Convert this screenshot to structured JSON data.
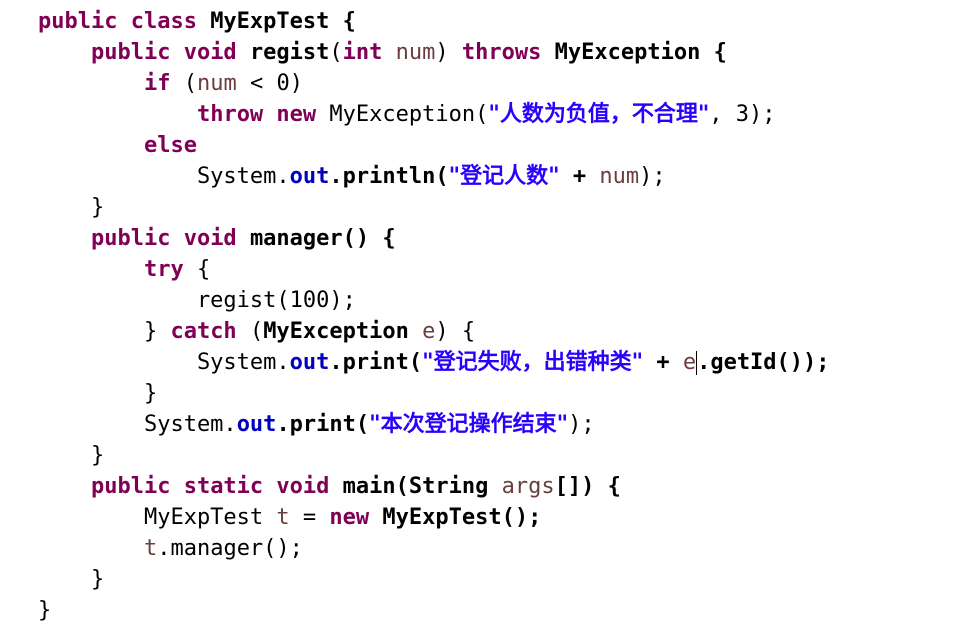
{
  "editor": {
    "lines": [
      {
        "tokens": [
          {
            "t": "public class ",
            "c": "kw"
          },
          {
            "t": "MyExpTest {",
            "c": "bold"
          }
        ]
      },
      {
        "tokens": [
          {
            "t": "    "
          },
          {
            "t": "public void ",
            "c": "kw"
          },
          {
            "t": "regist",
            "c": "bold"
          },
          {
            "t": "("
          },
          {
            "t": "int ",
            "c": "kw"
          },
          {
            "t": "num",
            "c": "var"
          },
          {
            "t": ") "
          },
          {
            "t": "throws ",
            "c": "kw"
          },
          {
            "t": "MyException {",
            "c": "bold"
          }
        ]
      },
      {
        "tokens": [
          {
            "t": "        "
          },
          {
            "t": "if ",
            "c": "kw"
          },
          {
            "t": "("
          },
          {
            "t": "num",
            "c": "var"
          },
          {
            "t": " < 0)"
          }
        ]
      },
      {
        "tokens": [
          {
            "t": "            "
          },
          {
            "t": "throw new ",
            "c": "kw"
          },
          {
            "t": "MyException("
          },
          {
            "t": "\"人数为负值，不合理\"",
            "c": "str-cn"
          },
          {
            "t": ", 3);"
          }
        ]
      },
      {
        "tokens": [
          {
            "t": "        "
          },
          {
            "t": "else",
            "c": "kw"
          }
        ]
      },
      {
        "tokens": [
          {
            "t": "            System."
          },
          {
            "t": "out",
            "c": "field"
          },
          {
            "t": ".println(",
            "c": "bold"
          },
          {
            "t": "\"登记人数\"",
            "c": "str-cn"
          },
          {
            "t": " + ",
            "c": "bold"
          },
          {
            "t": "num",
            "c": "var"
          },
          {
            "t": ");"
          }
        ]
      },
      {
        "tokens": [
          {
            "t": "    }"
          }
        ]
      },
      {
        "tokens": [
          {
            "t": "    "
          },
          {
            "t": "public void ",
            "c": "kw"
          },
          {
            "t": "manager() {",
            "c": "bold"
          }
        ]
      },
      {
        "tokens": [
          {
            "t": "        "
          },
          {
            "t": "try",
            "c": "kw"
          },
          {
            "t": " {"
          }
        ]
      },
      {
        "tokens": [
          {
            "t": "            regist(100);"
          }
        ]
      },
      {
        "tokens": [
          {
            "t": "        } "
          },
          {
            "t": "catch ",
            "c": "kw"
          },
          {
            "t": "("
          },
          {
            "t": "MyException ",
            "c": "bold"
          },
          {
            "t": "e",
            "c": "var"
          },
          {
            "t": ") {"
          }
        ]
      },
      {
        "tokens": [
          {
            "t": "            System."
          },
          {
            "t": "out",
            "c": "field"
          },
          {
            "t": ".print(",
            "c": "bold"
          },
          {
            "t": "\"登记失败，出错种类\"",
            "c": "str-cn"
          },
          {
            "t": " + ",
            "c": "bold"
          },
          {
            "t": "e",
            "c": "var"
          },
          {
            "t": "|",
            "c": "cursor"
          },
          {
            "t": ".getId());",
            "c": "bold"
          }
        ]
      },
      {
        "tokens": [
          {
            "t": "        }"
          }
        ]
      },
      {
        "tokens": [
          {
            "t": "        System."
          },
          {
            "t": "out",
            "c": "field"
          },
          {
            "t": ".print(",
            "c": "bold"
          },
          {
            "t": "\"本次登记操作结束\"",
            "c": "str-cn"
          },
          {
            "t": ");"
          }
        ]
      },
      {
        "tokens": [
          {
            "t": "    }"
          }
        ]
      },
      {
        "tokens": [
          {
            "t": "    "
          },
          {
            "t": "public static void ",
            "c": "kw"
          },
          {
            "t": "main(",
            "c": "bold"
          },
          {
            "t": "String ",
            "c": "bold"
          },
          {
            "t": "args",
            "c": "var"
          },
          {
            "t": "[]) {",
            "c": "bold"
          }
        ]
      },
      {
        "tokens": [
          {
            "t": "        MyExpTest "
          },
          {
            "t": "t",
            "c": "var"
          },
          {
            "t": " = "
          },
          {
            "t": "new ",
            "c": "kw"
          },
          {
            "t": "MyExpTest();",
            "c": "bold"
          }
        ]
      },
      {
        "tokens": [
          {
            "t": "        "
          },
          {
            "t": "t",
            "c": "var"
          },
          {
            "t": ".manager();"
          }
        ]
      },
      {
        "tokens": [
          {
            "t": "    }"
          }
        ]
      },
      {
        "tokens": [
          {
            "t": "}"
          }
        ]
      }
    ]
  },
  "colors": {
    "keyword": "#7f0055",
    "variable": "#6a3e3e",
    "field": "#0000c0",
    "string": "#2a00ff"
  }
}
